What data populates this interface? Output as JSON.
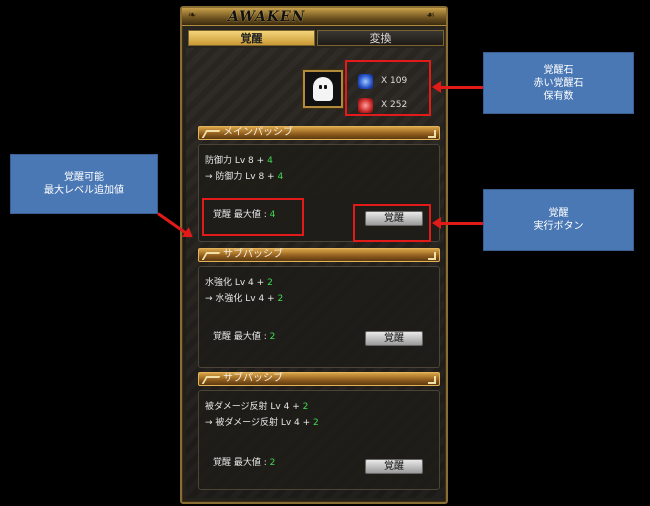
{
  "window": {
    "title": "AWAKEN"
  },
  "tabs": [
    {
      "label": "覚醒",
      "active": true
    },
    {
      "label": "変換",
      "active": false
    }
  ],
  "stones": {
    "blue": {
      "icon": "blue-awakening-stone-icon",
      "count_text": "X 109"
    },
    "red": {
      "icon": "red-awakening-stone-icon",
      "count_text": "X 252"
    }
  },
  "sections": [
    {
      "header": "メインパッシブ",
      "line1": {
        "text": "防御力 Lv 8 + ",
        "bonus": "4"
      },
      "line2": {
        "text": "→ 防御力 Lv 8 + ",
        "bonus": "4"
      },
      "max": {
        "text": "覚醒 最大値 : ",
        "value": "4"
      },
      "button": "覚醒"
    },
    {
      "header": "サブパッシブ",
      "line1": {
        "text": "水強化 Lv 4 + ",
        "bonus": "2"
      },
      "line2": {
        "text": "→ 水強化 Lv 4 + ",
        "bonus": "2"
      },
      "max": {
        "text": "覚醒 最大値 : ",
        "value": "2"
      },
      "button": "覚醒"
    },
    {
      "header": "サブパッシブ",
      "line1": {
        "text": "被ダメージ反射 Lv 4 + ",
        "bonus": "2"
      },
      "line2": {
        "text": "→ 被ダメージ反射 Lv 4 + ",
        "bonus": "2"
      },
      "max": {
        "text": "覚醒 最大値 : ",
        "value": "2"
      },
      "button": "覚醒"
    }
  ],
  "callouts": {
    "stones": [
      "覚醒石",
      "赤い覚醒石",
      "保有数"
    ],
    "max_level": [
      "覚醒可能",
      "最大レベル追加値"
    ],
    "execute": [
      "覚醒",
      "実行ボタン"
    ]
  },
  "colors": {
    "highlight": "#e21a1a",
    "callout_bg": "#4a78b5",
    "bonus_green": "#3fdc4f",
    "frame_gold": "#8a6d33"
  }
}
